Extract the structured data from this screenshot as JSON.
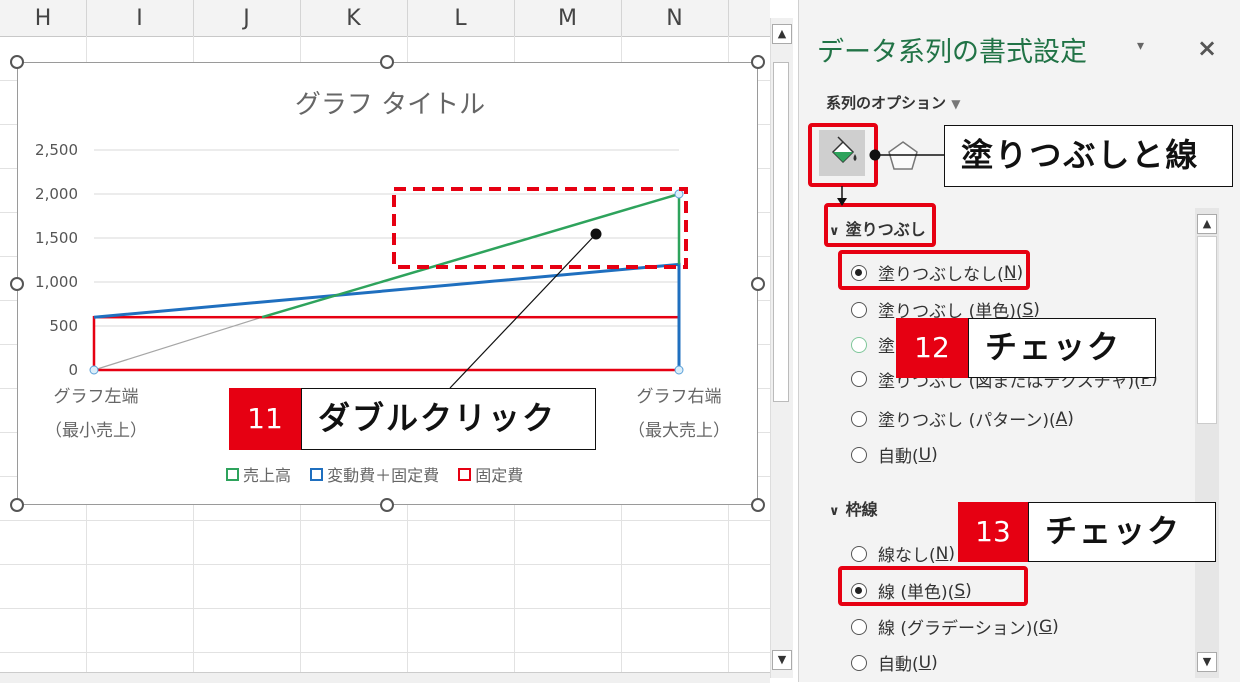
{
  "sheet": {
    "columns": [
      "H",
      "I",
      "J",
      "K",
      "L",
      "M",
      "N"
    ]
  },
  "chart": {
    "title": "グラフ タイトル",
    "y_ticks": [
      "2,500",
      "2,000",
      "1,500",
      "1,000",
      "500",
      "0"
    ],
    "cat_left": "グラフ左端",
    "cat_left_sub": "（最小売上）",
    "cat_right": "グラフ右端",
    "cat_right_sub": "（最大売上）",
    "legend": [
      "売上高",
      "変動費＋固定費",
      "固定費"
    ]
  },
  "chart_data": {
    "type": "line",
    "title": "グラフ タイトル",
    "categories": [
      "グラフ左端（最小売上）",
      "グラフ右端（最大売上）"
    ],
    "ylim": [
      0,
      2500
    ],
    "grid": true,
    "legend_position": "bottom",
    "series": [
      {
        "name": "売上高",
        "values": [
          0,
          2000
        ],
        "color": "#2ea35c"
      },
      {
        "name": "変動費＋固定費",
        "values": [
          600,
          1200
        ],
        "color": "#1f6fbf"
      },
      {
        "name": "固定費",
        "values": [
          600,
          600
        ],
        "color": "#e60012"
      }
    ]
  },
  "callouts": {
    "step11_num": "11",
    "step11_text": "ダブルクリック",
    "step12_num": "12",
    "step12_text": "チェック",
    "step13_num": "13",
    "step13_text": "チェック",
    "tab_label": "塗りつぶしと線"
  },
  "pane": {
    "title": "データ系列の書式設定",
    "menu_icon": "▾",
    "close_icon": "×",
    "series_options": "系列のオプション",
    "fill_section": "塗りつぶし",
    "fill_options": [
      {
        "label": "塗りつぶしなし(",
        "key": "N",
        "tail": ")",
        "selected": true
      },
      {
        "label": "塗りつぶし (単色)(",
        "key": "S",
        "tail": ")",
        "selected": false
      },
      {
        "label": "塗",
        "key": "",
        "tail": "",
        "selected": false
      },
      {
        "label": "塗りつぶし (図またはテクスチャ)(",
        "key": "P",
        "tail": ")",
        "selected": false
      },
      {
        "label": "塗りつぶし (パターン)(",
        "key": "A",
        "tail": ")",
        "selected": false
      },
      {
        "label": "自動(",
        "key": "U",
        "tail": ")",
        "selected": false
      }
    ],
    "border_section": "枠線",
    "border_options": [
      {
        "label": "線なし(",
        "key": "N",
        "tail": ")",
        "selected": false
      },
      {
        "label": "線 (単色)(",
        "key": "S",
        "tail": ")",
        "selected": true
      },
      {
        "label": "線 (グラデーション)(",
        "key": "G",
        "tail": ")",
        "selected": false
      },
      {
        "label": "自動(",
        "key": "U",
        "tail": ")",
        "selected": false
      }
    ]
  },
  "colors": {
    "accent_red": "#e60012",
    "excel_green": "#217346",
    "sales_green": "#2ea35c",
    "cost_blue": "#1f6fbf"
  }
}
